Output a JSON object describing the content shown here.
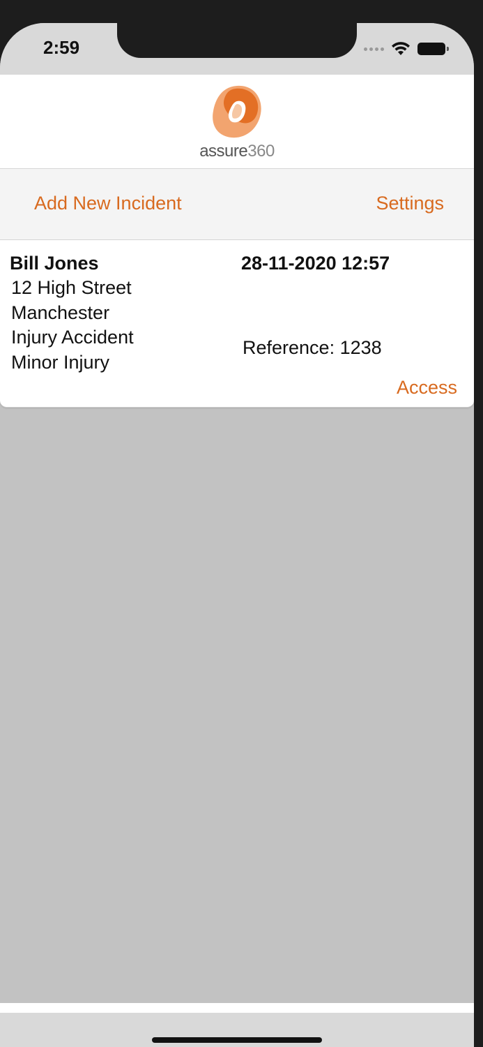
{
  "status_bar": {
    "time": "2:59",
    "icons": [
      "signal-dots-icon",
      "wifi-icon",
      "battery-icon"
    ]
  },
  "header": {
    "logo_word": "assure",
    "logo_num": "360",
    "logo_colors": [
      "#e36f25",
      "#f2a46f"
    ]
  },
  "navbar": {
    "left_label": "Add New Incident",
    "right_label": "Settings"
  },
  "incidents": [
    {
      "name": "Bill Jones",
      "address_line1": "12 High Street",
      "address_line2": "Manchester",
      "type": "Injury Accident",
      "severity": "Minor Injury",
      "datetime": "28-11-2020 12:57",
      "reference": "Reference: 1238",
      "action_label": "Access"
    }
  ],
  "colors": {
    "accent": "#d86a1f",
    "list_background": "#c2c2c2",
    "navbar_background": "#f4f4f4"
  }
}
